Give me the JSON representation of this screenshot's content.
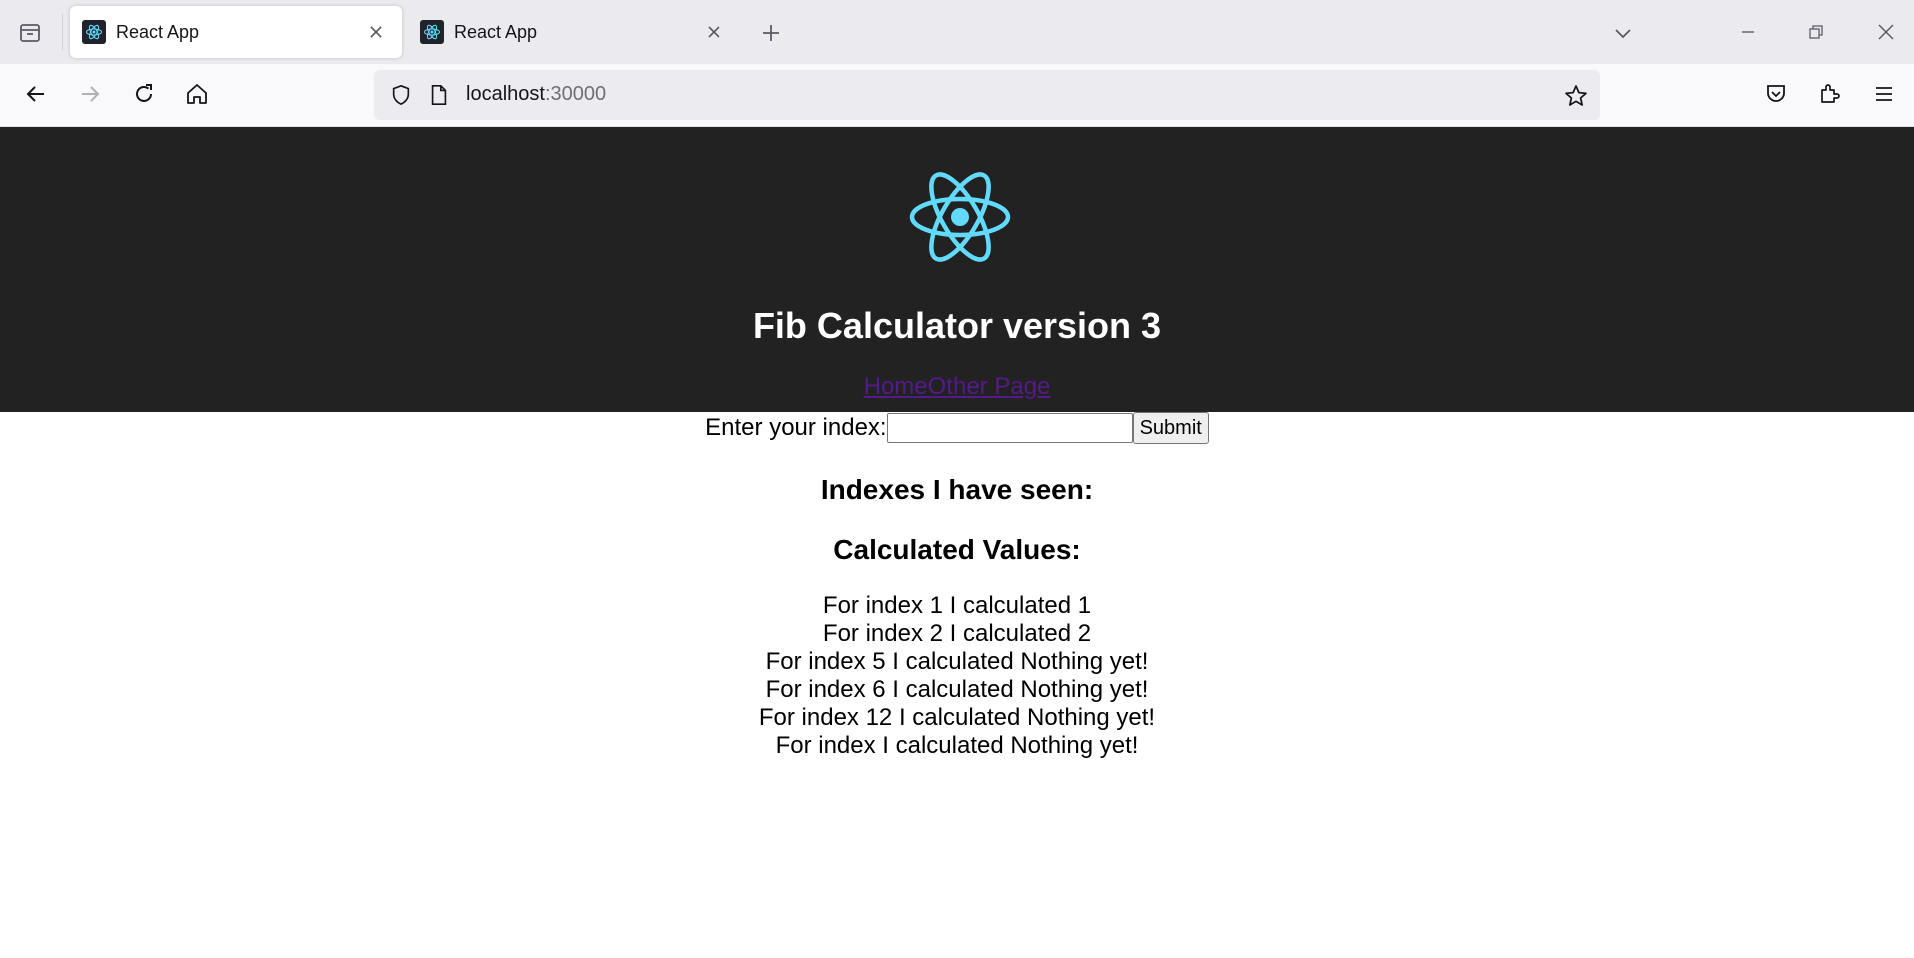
{
  "browser": {
    "tabs": [
      {
        "title": "React App",
        "active": true
      },
      {
        "title": "React App",
        "active": false
      }
    ],
    "url_host": "localhost",
    "url_port": ":30000"
  },
  "app": {
    "title": "Fib Calculator version 3",
    "nav": {
      "home": "Home",
      "other": "Other Page"
    },
    "form": {
      "label": "Enter your index:",
      "input_value": "",
      "submit_label": "Submit"
    },
    "indexes_heading": "Indexes I have seen:",
    "values_heading": "Calculated Values:",
    "values": [
      "For index 1 I calculated 1",
      "For index 2 I calculated 2",
      "For index 5 I calculated Nothing yet!",
      "For index 6 I calculated Nothing yet!",
      "For index 12 I calculated Nothing yet!",
      "For index I calculated Nothing yet!"
    ]
  },
  "colors": {
    "header_bg": "#222222",
    "react_blue": "#61dafb",
    "visited_link": "#551a8b"
  }
}
